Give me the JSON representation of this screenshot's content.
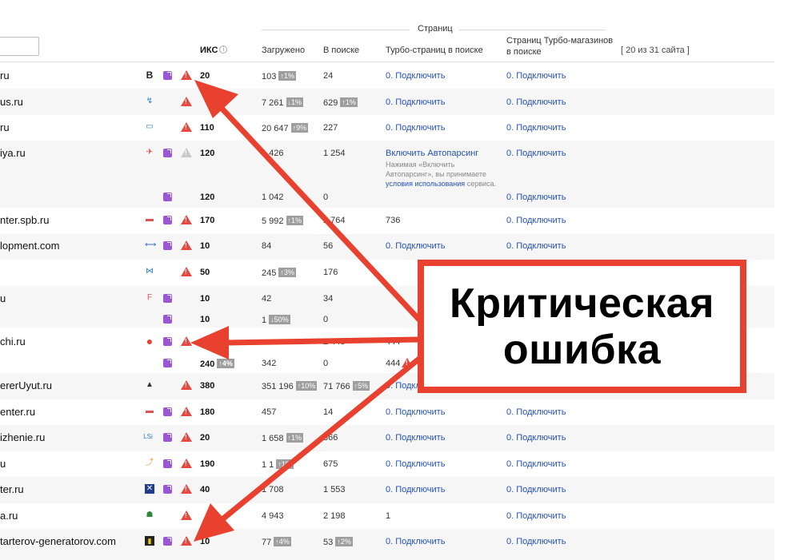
{
  "header": {
    "iks": "ИКС",
    "info_glyph": "i",
    "group_title": "Страниц",
    "loaded": "Загружено",
    "in_search": "В поиске",
    "turbo": "Турбо-страниц в поиске",
    "shop_line1": "Страниц Турбо-магазинов",
    "shop_line2": "в поиске",
    "count": "[ 20 из 31 сайта ]"
  },
  "rows": {
    "r0": {
      "site": "ru",
      "fav": "B",
      "iks": "20",
      "loaded": "103",
      "loaded_badge": "↑1%",
      "insearch": "24",
      "turbo": "0. Подключить",
      "shop": "0. Подключить"
    },
    "r1": {
      "site": "us.ru",
      "fav": "↯",
      "iks": "",
      "loaded": "7 261",
      "loaded_badge": "↓1%",
      "insearch": "629",
      "insearch_badge": "↑1%",
      "turbo": "0. Подключить",
      "shop": "0. Подключить"
    },
    "r2": {
      "site": "ru",
      "fav": "▭",
      "iks": "110",
      "loaded": "20 647",
      "loaded_badge": "↑9%",
      "insearch": "227",
      "turbo": "0. Подключить",
      "shop": "0. Подключить"
    },
    "r3": {
      "site": "iya.ru",
      "fav": "✈",
      "iks": "120",
      "loaded": "1 426",
      "insearch": "1 254",
      "turbo": "Включить Автопарсинг",
      "note1": "Нажимая «Включить",
      "note2": "Автопарсинг», вы принимаете",
      "note3_link": "условия использования",
      "note3_rest": " сервиса.",
      "shop": "0. Подключить"
    },
    "r3b": {
      "iks": "120",
      "loaded": "1 042",
      "insearch": "0",
      "shop": "0. Подключить"
    },
    "r4": {
      "site": "nter.spb.ru",
      "fav": "▬",
      "iks": "170",
      "loaded": "5 992",
      "loaded_badge": "↑1%",
      "insearch": "2 764",
      "turbo": "736",
      "shop": "0. Подключить"
    },
    "r5": {
      "site": "lopment.com",
      "fav": "⟷",
      "iks": "10",
      "loaded": "84",
      "insearch": "56",
      "turbo": "0. Подключить",
      "shop": "0. Подключить"
    },
    "r6": {
      "site": "",
      "fav": "⋈",
      "iks": "50",
      "loaded": "245",
      "loaded_badge": "↑3%",
      "insearch": "176",
      "turbo": "",
      "shop": ""
    },
    "r7": {
      "site": "u",
      "fav": "F",
      "iks": "10",
      "loaded": "42",
      "insearch": "34",
      "turbo": "",
      "shop": ""
    },
    "r7b": {
      "iks": "10",
      "loaded": "1",
      "loaded_badge": "↓50%",
      "insearch": "0"
    },
    "r8": {
      "site": "chi.ru",
      "fav": "●",
      "iks": "",
      "loaded": "",
      "insearch": "2 443",
      "turbo": "444",
      "shop": ""
    },
    "r8b": {
      "iks": "240",
      "iks_badge": "↑4%",
      "loaded": "342",
      "insearch": "0",
      "turbo": "444"
    },
    "r9": {
      "site": "ererUyut.ru",
      "fav": "▲",
      "iks": "380",
      "loaded": "351 196",
      "loaded_badge": "↑10%",
      "insearch": "71 766",
      "insearch_badge": "↑5%",
      "turbo": "0. Подключить",
      "shop": ""
    },
    "r10": {
      "site": "enter.ru",
      "fav": "▬",
      "iks": "180",
      "loaded": "457",
      "insearch": "14",
      "turbo": "0. Подключить",
      "shop": "0. Подключить"
    },
    "r11": {
      "site": "izhenie.ru",
      "fav": "LSi",
      "iks": "20",
      "loaded": "1 658",
      "loaded_badge": "↑1%",
      "insearch": "866",
      "turbo": "0. Подключить",
      "shop": "0. Подключить"
    },
    "r12": {
      "site": "u",
      "fav": "⤴",
      "iks": "190",
      "loaded": "1 1",
      "loaded_badge": "↑1%",
      "insearch": "675",
      "turbo": "0. Подключить",
      "shop": "0. Подключить"
    },
    "r13": {
      "site": "ter.ru",
      "fav": "✕",
      "iks": "40",
      "loaded": "1 708",
      "insearch": "1 553",
      "turbo": "0. Подключить",
      "shop": "0. Подключить"
    },
    "r14": {
      "site": "a.ru",
      "fav": "☗",
      "iks": "",
      "loaded": "4 943",
      "insearch": "2 198",
      "turbo": "1",
      "shop": "0. Подключить"
    },
    "r15": {
      "site": "tarterov-generatorov.com",
      "fav": "▮",
      "iks": "10",
      "loaded": "77",
      "loaded_badge": "↑4%",
      "insearch": "53",
      "insearch_badge": "↑2%",
      "turbo": "0. Подключить",
      "shop": "0. Подключить"
    }
  },
  "callout": {
    "line1": "Критическая",
    "line2": "ошибка"
  },
  "colors": {
    "accent_red": "#e8412f",
    "link_blue": "#2352b8",
    "turbo_purple": "#9b57d3",
    "row_alt": "#f6f6f6"
  }
}
